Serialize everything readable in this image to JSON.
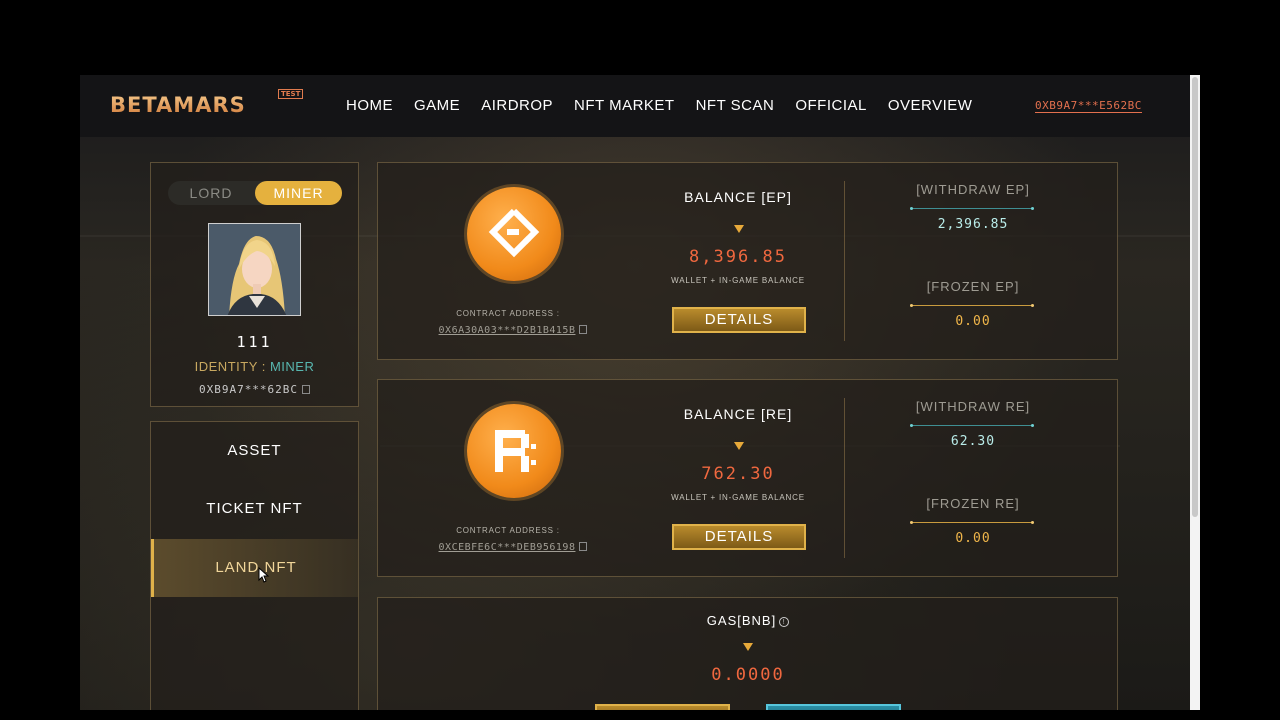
{
  "header": {
    "logo": "BETAMARS",
    "logo_badge": "TEST",
    "nav": [
      "HOME",
      "GAME",
      "AIRDROP",
      "NFT MARKET",
      "NFT SCAN",
      "OFFICIAL",
      "OVERVIEW"
    ],
    "wallet": "0XB9A7***E562BC"
  },
  "profile": {
    "role_lord": "LORD",
    "role_miner": "MINER",
    "selected_role": "MINER",
    "username": "111",
    "identity_label": "IDENTITY : ",
    "identity_value": "MINER",
    "address": "0XB9A7***62BC"
  },
  "side_menu": {
    "items": [
      "ASSET",
      "TICKET NFT",
      "LAND NFT"
    ],
    "active": "LAND NFT"
  },
  "cards": {
    "ep": {
      "contract_label": "CONTRACT ADDRESS :",
      "contract_address": "0X6A30A03***D2B1B415B",
      "balance_title": "BALANCE [EP]",
      "balance_value": "8,396.85",
      "balance_sub": "WALLET + IN-GAME BALANCE",
      "details": "DETAILS",
      "withdraw_title": "[WITHDRAW EP]",
      "withdraw_value": "2,396.85",
      "frozen_title": "[FROZEN EP]",
      "frozen_value": "0.00"
    },
    "re": {
      "contract_label": "CONTRACT ADDRESS :",
      "contract_address": "0XCEBFE6C***DEB956198",
      "balance_title": "BALANCE [RE]",
      "balance_value": "762.30",
      "balance_sub": "WALLET + IN-GAME BALANCE",
      "details": "DETAILS",
      "withdraw_title": "[WITHDRAW RE]",
      "withdraw_value": "62.30",
      "frozen_title": "[FROZEN RE]",
      "frozen_value": "0.00"
    },
    "gas": {
      "title": "GAS[BNB]",
      "info_glyph": "!",
      "value": "0.0000"
    }
  },
  "colors": {
    "accent_orange": "#f0683f",
    "accent_gold": "#e5b13e",
    "teal": "#58b7b0"
  }
}
